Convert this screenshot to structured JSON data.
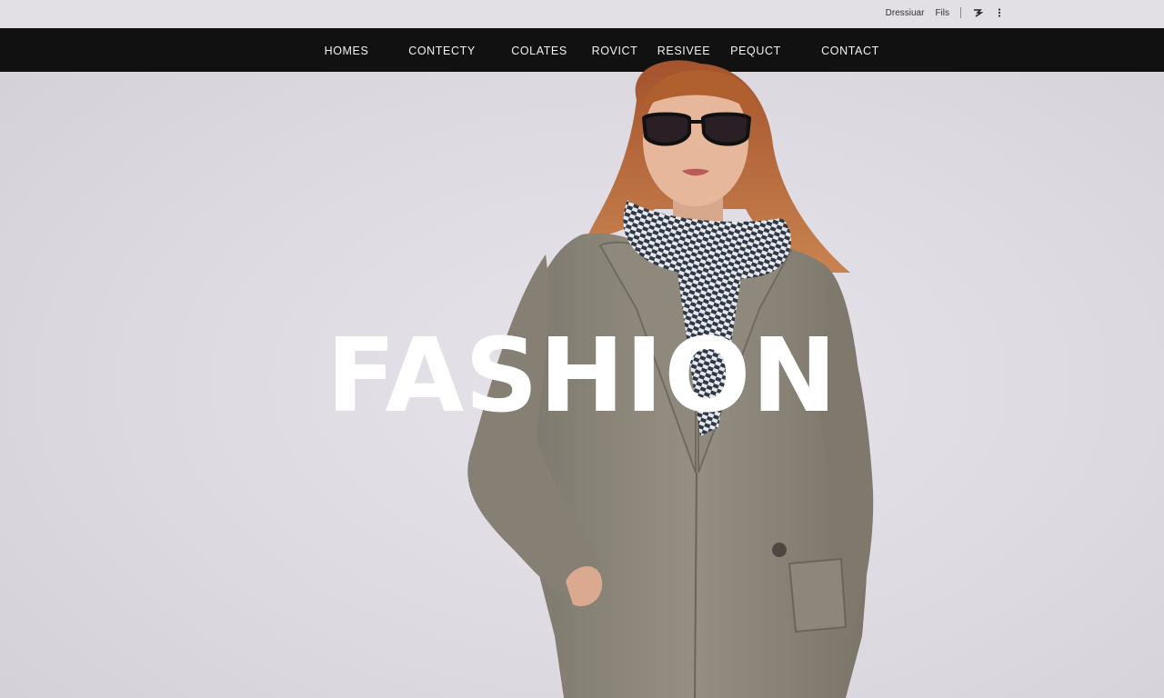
{
  "utility": {
    "links": [
      "Dressiuar",
      "Fils"
    ],
    "icons": [
      "logo-mark-icon",
      "more-vertical-icon"
    ]
  },
  "nav": {
    "items": [
      {
        "label": "HOMES"
      },
      {
        "label": "CONTECTY"
      },
      {
        "label": "COLATES"
      },
      {
        "label": "ROVICT"
      },
      {
        "label": "RESIVEE"
      },
      {
        "label": "PEQUCT"
      },
      {
        "label": "CONTACT"
      }
    ]
  },
  "hero": {
    "title": "FASHION"
  },
  "colors": {
    "nav_background": "#111112",
    "page_background": "#dcdae0",
    "hero_text": "#ffffff",
    "coat": "#8b8579",
    "hair": "#b8643a"
  }
}
